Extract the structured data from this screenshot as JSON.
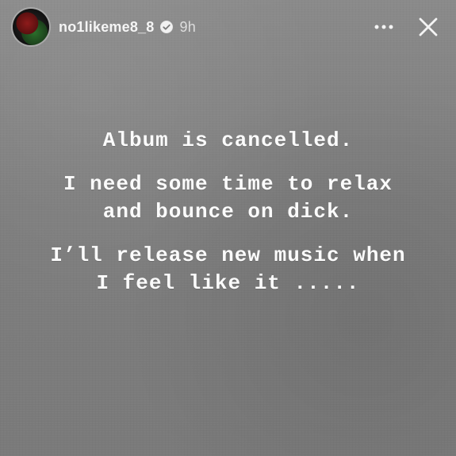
{
  "story": {
    "username": "no1likeme8_8",
    "time_ago": "9h",
    "text_lines": [
      "Album is cancelled.",
      "I need some time to relax",
      "and bounce on dick.",
      "I’ll release new music when",
      "I feel like it ....."
    ]
  },
  "icons": {
    "verified": "verified-check",
    "more": "more-horizontal",
    "close": "close-x"
  },
  "colors": {
    "text": "#FFFFFF",
    "background": "#808080"
  }
}
